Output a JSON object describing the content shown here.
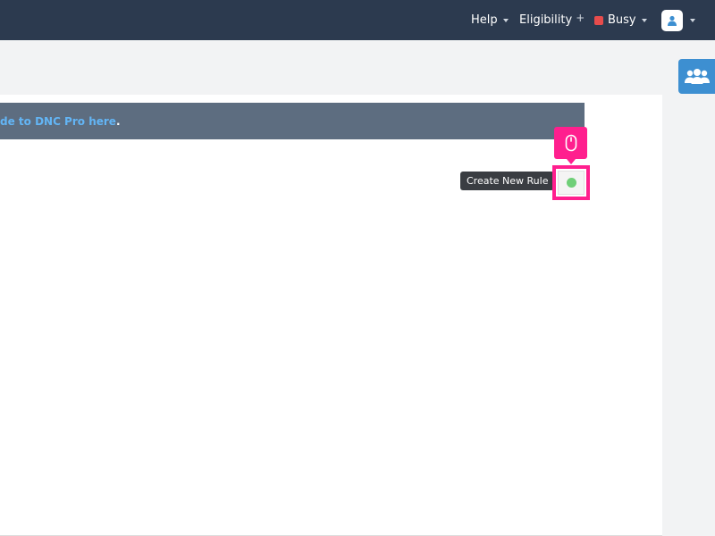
{
  "navbar": {
    "help_label": "Help",
    "eligibility_label": "Eligibility",
    "eligibility_plus": "+",
    "status_label": "Busy",
    "status_color": "#e74c4c",
    "background_color": "#2c3a4f",
    "user_icon": "user-icon",
    "help_caret_icon": "caret-down-icon",
    "status_caret_icon": "caret-down-icon",
    "user_caret_icon": "caret-down-icon"
  },
  "right_rail": {
    "team_icon": "team-icon",
    "team_button_color": "#3d8fd1"
  },
  "banner": {
    "link_text": "de to DNC Pro here",
    "trailing_text": ".",
    "background_color": "#5d6d80",
    "link_color": "#63b5f5"
  },
  "rule_action": {
    "tooltip_text": "Create New Rule",
    "button_icon": "green-dot-icon",
    "highlight_color": "#ff1f8e",
    "click_indicator_icon": "mouse-icon"
  }
}
